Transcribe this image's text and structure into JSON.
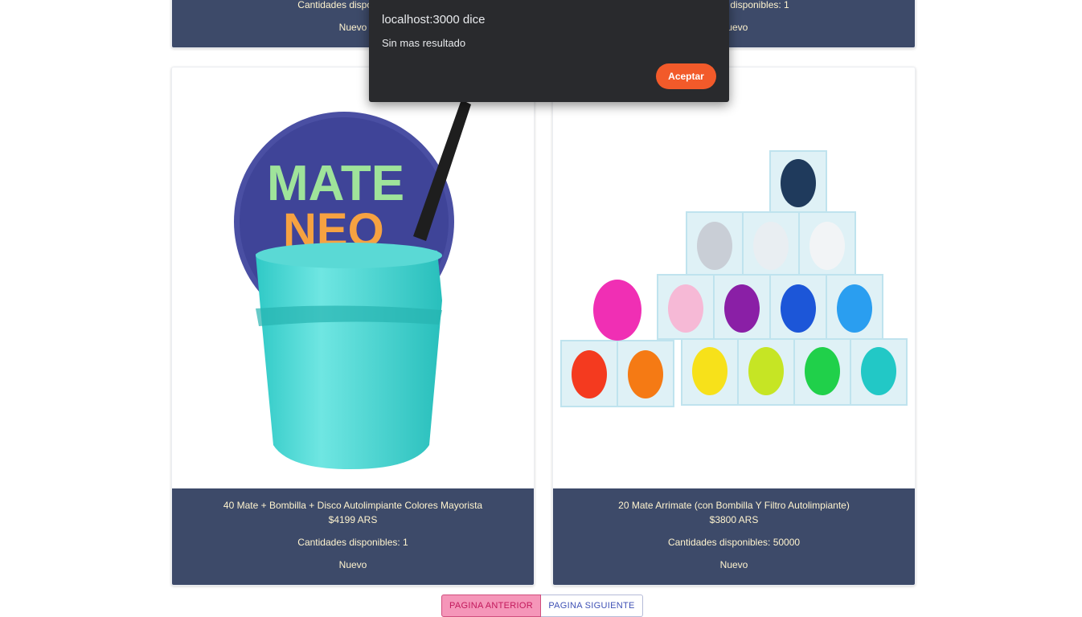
{
  "top_cards": [
    {
      "stock": "Cantidades disponibles: 1",
      "condition": "Nuevo"
    },
    {
      "stock": "Cantidades disponibles: 1",
      "condition": "Nuevo"
    }
  ],
  "products": [
    {
      "title": "40 Mate + Bombilla + Disco Autolimpiante Colores Mayorista",
      "price": "$4199 ARS",
      "stock": "Cantidades disponibles: 1",
      "condition": "Nuevo",
      "image_text": [
        "MATE",
        "NEO"
      ]
    },
    {
      "title": "20 Mate Arrimate (con Bombilla Y Filtro Autolimpiante)",
      "price": "$3800 ARS",
      "stock": "Cantidades disponibles: 50000",
      "condition": "Nuevo"
    }
  ],
  "pagination": {
    "prev_label": "PAGINA ANTERIOR",
    "next_label": "PAGINA SIGUIENTE"
  },
  "alert": {
    "title": "localhost:3000 dice",
    "message": "Sin mas resultado",
    "ok_label": "Aceptar"
  },
  "colors": {
    "card_footer": "#3d4a69",
    "card_text": "#fff4cf",
    "alert_bg": "#292a2d",
    "alert_button": "#f25a2a",
    "prev_button": "#f596b9",
    "next_text": "#3f51b5"
  }
}
